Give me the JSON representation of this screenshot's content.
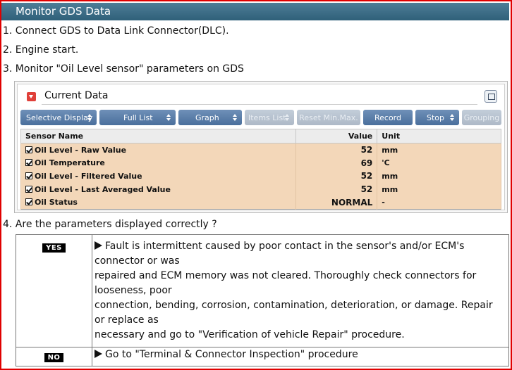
{
  "header": {
    "title": "Monitor GDS Data"
  },
  "steps": {
    "s1": "1. Connect GDS to Data Link Connector(DLC).",
    "s2": "2. Engine start.",
    "s3": "3. Monitor \"Oil Level sensor\" parameters on GDS",
    "s4": "4. Are the parameters displayed correctly ?"
  },
  "current_data": {
    "title": "Current Data",
    "toolbar": {
      "selective_display": "Selective Display",
      "full_list": "Full List",
      "graph": "Graph",
      "items_list": "Items List",
      "reset_min_max": "Reset Min.Max.",
      "record": "Record",
      "stop": "Stop",
      "grouping": "Grouping"
    },
    "columns": {
      "name": "Sensor Name",
      "value": "Value",
      "unit": "Unit"
    },
    "rows": [
      {
        "name": "Oil Level - Raw Value",
        "value": "52",
        "unit": "mm"
      },
      {
        "name": "Oil Temperature",
        "value": "69",
        "unit": "'C"
      },
      {
        "name": "Oil Level - Filtered Value",
        "value": "52",
        "unit": "mm"
      },
      {
        "name": "Oil Level - Last Averaged Value",
        "value": "52",
        "unit": "mm"
      },
      {
        "name": "Oil Status",
        "value": "NORMAL",
        "unit": "-"
      }
    ]
  },
  "results": {
    "yes_label": "YES",
    "yes_lines": [
      "Fault is intermittent caused by poor contact in the sensor's and/or ECM's",
      "connector or was",
      "repaired and ECM memory was not cleared. Thoroughly check connectors for",
      "looseness, poor",
      "connection, bending, corrosion, contamination, deterioration, or damage. Repair",
      "or replace as",
      "necessary and go to \"Verification of vehicle Repair\" procedure."
    ],
    "no_label": "NO",
    "no_text": "Go to \"Terminal & Connector Inspection\" procedure"
  },
  "colors": {
    "frame_border": "#e00000",
    "header_bg": "#3a6b85",
    "toolbar_button": "#5a7fab",
    "data_row_bg": "#f3d7b9"
  }
}
